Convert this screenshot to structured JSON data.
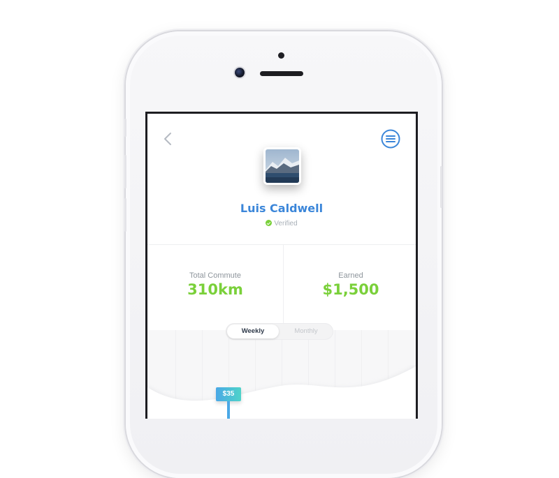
{
  "profile": {
    "name": "Luis Caldwell",
    "status": "Verified"
  },
  "stats": {
    "commute_label": "Total Commute",
    "commute_value": "310km",
    "earned_label": "Earned",
    "earned_value": "$1,500"
  },
  "toggle": {
    "options": [
      "Weekly",
      "Monthly"
    ],
    "selected": "Weekly"
  },
  "chart": {
    "marker_value": "$35"
  },
  "icons": {
    "back": "chevron-left-icon",
    "menu": "menu-circle-icon",
    "verified": "check-circle-icon"
  },
  "colors": {
    "accent_blue": "#3b86d9",
    "accent_green": "#7ad03a",
    "tag_gradient_start": "#4aa8e6",
    "tag_gradient_end": "#4fd3c9"
  }
}
